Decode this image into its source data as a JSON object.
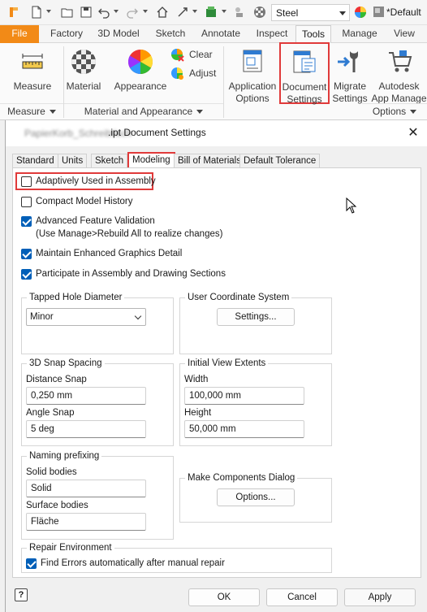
{
  "quick_access": {
    "icons": [
      "new-file-icon",
      "open-folder-icon",
      "save-icon",
      "undo-icon",
      "redo-icon",
      "home-icon",
      "update-icon",
      "ipart-icon",
      "select-filter-icon",
      "material-sphere-icon"
    ],
    "material_value": "Steel",
    "appearance_value": "*Default"
  },
  "ribbon": {
    "tabs": [
      "File",
      "Factory",
      "3D Model",
      "Sketch",
      "Annotate",
      "Inspect",
      "Tools",
      "Manage",
      "View"
    ],
    "active_tab": "Tools",
    "buttons": {
      "measure": "Measure",
      "material": "Material",
      "appearance": "Appearance",
      "clear": "Clear",
      "adjust": "Adjust",
      "app_options_1": "Application",
      "app_options_2": "Options",
      "doc_settings_1": "Document",
      "doc_settings_2": "Settings",
      "migrate_1": "Migrate",
      "migrate_2": "Settings",
      "app_manager_1": "Autodesk",
      "app_manager_2": "App Manage"
    },
    "groups": {
      "measure": "Measure",
      "material_appearance": "Material and Appearance",
      "options": "Options"
    }
  },
  "dialog": {
    "title_blurred": "PapierKorb_Schreibtisch",
    "title": ".ipt Document Settings",
    "tabs": [
      "Standard",
      "Units",
      "Sketch",
      "Modeling",
      "Bill of Materials",
      "Default Tolerance"
    ],
    "active_tab": "Modeling",
    "checkboxes": [
      {
        "label": "Adaptively Used in Assembly",
        "checked": false
      },
      {
        "label": "Compact Model History",
        "checked": false
      },
      {
        "label": "Advanced Feature Validation",
        "checked": true
      },
      {
        "label": "Maintain Enhanced Graphics Detail",
        "checked": true
      },
      {
        "label": "Participate in Assembly and Drawing Sections",
        "checked": true
      }
    ],
    "advanced_note": "(Use Manage>Rebuild All to realize changes)",
    "tapped_hole": {
      "legend": "Tapped Hole Diameter",
      "value": "Minor"
    },
    "ucs": {
      "legend": "User Coordinate System",
      "button": "Settings..."
    },
    "snap": {
      "legend": "3D Snap Spacing",
      "distance_label": "Distance Snap",
      "distance_value": "0,250 mm",
      "angle_label": "Angle Snap",
      "angle_value": "5 deg"
    },
    "view_extents": {
      "legend": "Initial View Extents",
      "width_label": "Width",
      "width_value": "100,000 mm",
      "height_label": "Height",
      "height_value": "50,000 mm"
    },
    "naming": {
      "legend": "Naming prefixing",
      "solid_label": "Solid bodies",
      "solid_value": "Solid",
      "surface_label": "Surface bodies",
      "surface_value": "Fläche"
    },
    "components": {
      "legend": "Make Components Dialog",
      "button": "Options..."
    },
    "repair": {
      "legend": "Repair Environment",
      "checkbox_label": "Find Errors automatically after manual repair",
      "checked": true
    },
    "footer": {
      "help": "?",
      "ok": "OK",
      "cancel": "Cancel",
      "apply": "Apply"
    }
  },
  "colors": {
    "file_tab": "#f28a17",
    "highlight": "#e03a3a",
    "checkbox_checked": "#005fb8"
  }
}
